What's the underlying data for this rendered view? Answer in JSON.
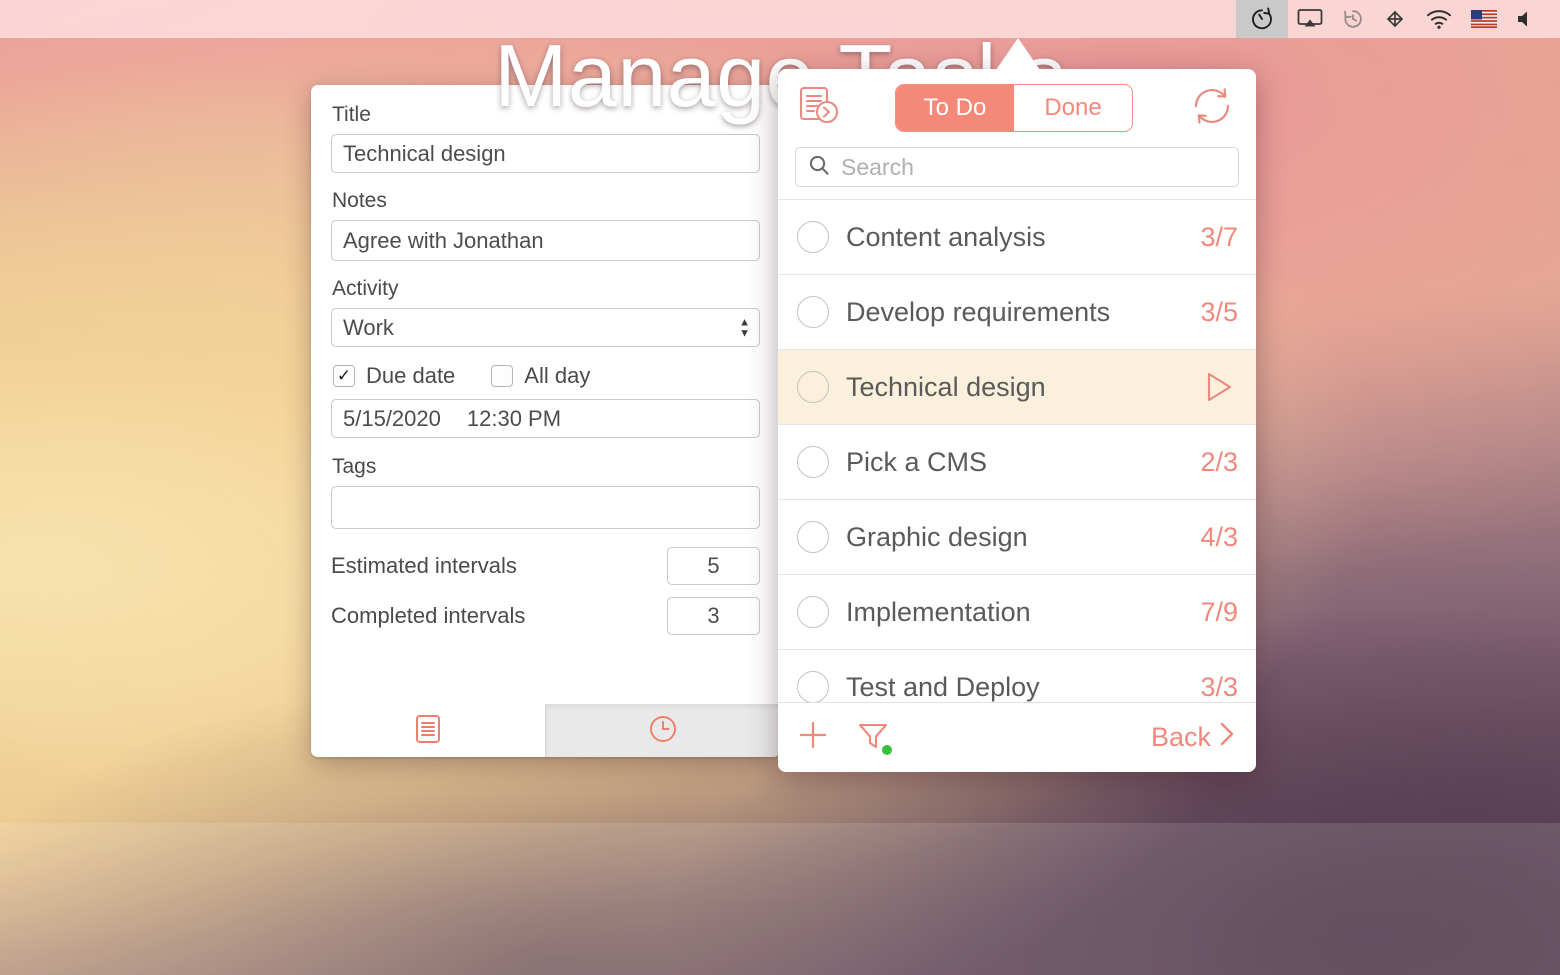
{
  "menubar": {
    "icons": [
      {
        "name": "timer-icon",
        "label": "Timer",
        "active": true
      },
      {
        "name": "airplay-icon",
        "label": "AirPlay",
        "active": false
      },
      {
        "name": "time-machine-icon",
        "label": "Time Machine",
        "active": false
      },
      {
        "name": "bluetooth-share-icon",
        "label": "Share",
        "active": false
      },
      {
        "name": "wifi-icon",
        "label": "Wi-Fi",
        "active": false
      },
      {
        "name": "us-flag-icon",
        "label": "Input source: US",
        "active": false
      },
      {
        "name": "volume-icon",
        "label": "Volume",
        "active": false
      }
    ]
  },
  "detail": {
    "title_label": "Title",
    "title_value": "Technical design",
    "notes_label": "Notes",
    "notes_value": "Agree with Jonathan",
    "activity_label": "Activity",
    "activity_value": "Work",
    "due_date_label": "Due date",
    "all_day_label": "All day",
    "due_date_checked": "✓",
    "all_day_checked": "",
    "date_value": "5/15/2020",
    "time_value": "12:30 PM",
    "tags_label": "Tags",
    "tags_value": "",
    "estimated_label": "Estimated intervals",
    "estimated_value": "5",
    "completed_label": "Completed intervals",
    "completed_value": "3",
    "tabs": [
      {
        "name": "tab-details",
        "icon": "list-document-icon",
        "active": true
      },
      {
        "name": "tab-history",
        "icon": "clock-icon",
        "active": false
      }
    ]
  },
  "popover": {
    "report_icon": "document-export-icon",
    "sync_icon": "sync-refresh-icon",
    "segments": [
      {
        "label": "To Do",
        "selected": true
      },
      {
        "label": "Done",
        "selected": false
      }
    ],
    "search": {
      "icon": "search-icon",
      "placeholder": "Search",
      "value": ""
    },
    "tasks": [
      {
        "title": "Content analysis",
        "count": "3/7",
        "highlighted": false,
        "running": false
      },
      {
        "title": "Develop requirements",
        "count": "3/5",
        "highlighted": false,
        "running": false
      },
      {
        "title": "Technical design",
        "count": "",
        "highlighted": true,
        "running": true
      },
      {
        "title": "Pick a CMS",
        "count": "2/3",
        "highlighted": false,
        "running": false
      },
      {
        "title": "Graphic design",
        "count": "4/3",
        "highlighted": false,
        "running": false
      },
      {
        "title": "Implementation",
        "count": "7/9",
        "highlighted": false,
        "running": false
      },
      {
        "title": "Test and Deploy",
        "count": "3/3",
        "highlighted": false,
        "running": false
      }
    ],
    "footer": {
      "add_icon": "plus-icon",
      "filter_icon": "filter-funnel-icon",
      "filter_active_dot_color": "#35c23a",
      "back_label": "Back",
      "back_chevron_icon": "chevron-right-icon"
    }
  },
  "caption": {
    "text": "Manage Tasks"
  },
  "colors": {
    "accent": "#f0897c",
    "accent_strong": "#f4897a",
    "highlight_row": "#fbf0dc",
    "text_primary": "#5a5a5a",
    "text_label": "#4a4a4a",
    "filter_dot": "#35c23a"
  }
}
